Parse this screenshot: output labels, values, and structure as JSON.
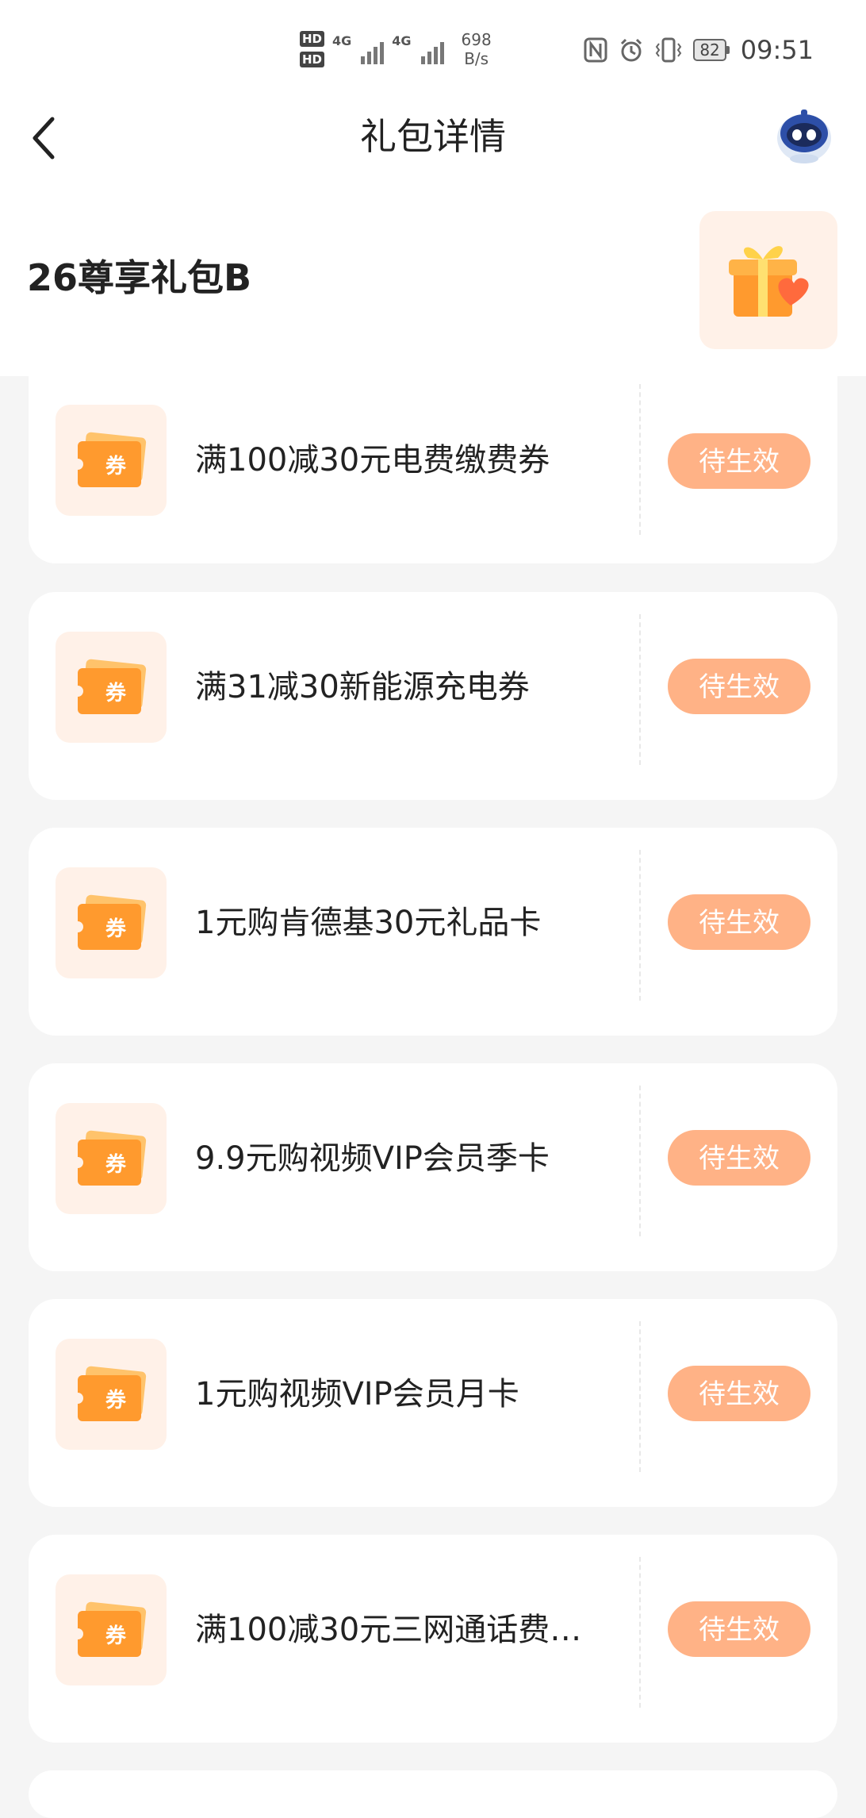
{
  "status_bar": {
    "hd1": "HD",
    "hd2": "HD",
    "net1": "4G",
    "net2": "4G",
    "speed_value": "698",
    "speed_unit": "B/s",
    "battery": "82",
    "time": "09:51"
  },
  "nav": {
    "title": "礼包详情"
  },
  "gift": {
    "name": "26尊享礼包B"
  },
  "coupons": [
    {
      "title": "满100减30元电费缴费券",
      "status": "待生效"
    },
    {
      "title": "满31减30新能源充电券",
      "status": "待生效"
    },
    {
      "title": "1元购肯德基30元礼品卡",
      "status": "待生效"
    },
    {
      "title": "9.9元购视频VIP会员季卡",
      "status": "待生效"
    },
    {
      "title": "1元购视频VIP会员月卡",
      "status": "待生效"
    },
    {
      "title": "满100减30元三网通话费…",
      "status": "待生效"
    }
  ],
  "coupon_icon_text": "券",
  "colors": {
    "status_button_bg": "#ffb286",
    "icon_bg": "#fff1e8",
    "coupon_orange": "#ff9a2e"
  }
}
